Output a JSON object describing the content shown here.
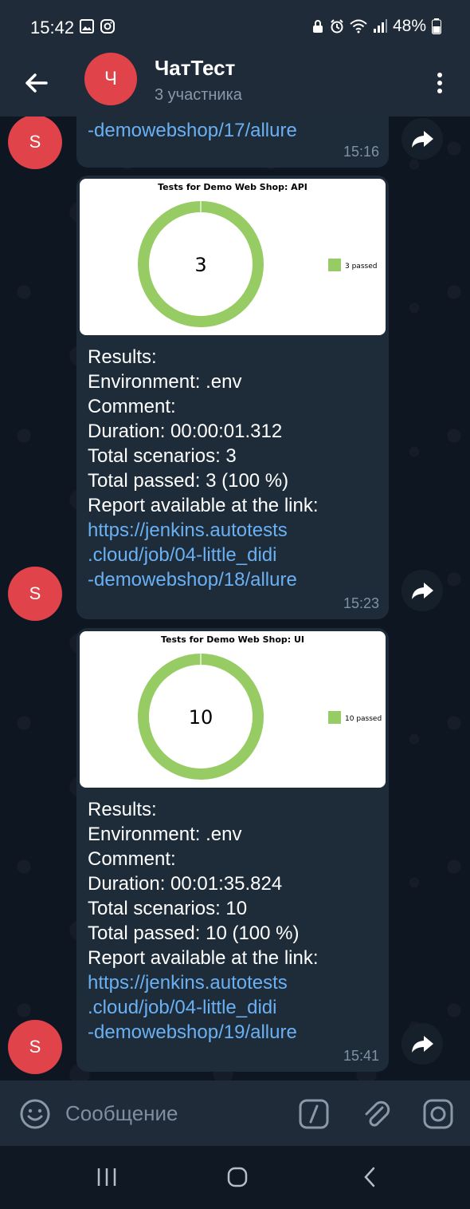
{
  "statusbar": {
    "time": "15:42",
    "battery": "48%",
    "icons_left": [
      "image-icon",
      "instagram-icon"
    ],
    "icons_right": [
      "lock-icon",
      "alarm-icon",
      "wifi-icon",
      "signal-icon",
      "battery-icon"
    ]
  },
  "header": {
    "avatar_letter": "Ч",
    "title": "ЧатТест",
    "subtitle": "3 участника"
  },
  "messages": [
    {
      "avatar": "S",
      "link_tail": "-demowebshop/17/allure",
      "time": "15:16"
    },
    {
      "avatar": "S",
      "chart_data": {
        "type": "pie",
        "title": "Tests for Demo Web Shop: API",
        "center_label": "3",
        "series": [
          {
            "name": "3 passed",
            "values": [
              3
            ]
          }
        ],
        "legend": "right",
        "color": "#97cc64"
      },
      "lines": [
        {
          "label": "Results:",
          "value": ""
        },
        {
          "label": "Environment:",
          "value": " .env"
        },
        {
          "label": "Comment:",
          "value": ""
        },
        {
          "label": "Duration:",
          "value": " 00:00:01.312"
        },
        {
          "label": "Total scenarios:",
          "value": " 3"
        },
        {
          "label": "Total passed:",
          "value": " 3 (100 %)"
        },
        {
          "label": "Report available at the link:",
          "value": ""
        }
      ],
      "link_lines": [
        "https://jenkins.autotests",
        ".cloud/job/04-little_didi",
        "-demowebshop/18/allure"
      ],
      "time": "15:23"
    },
    {
      "avatar": "S",
      "chart_data": {
        "type": "pie",
        "title": "Tests for Demo Web Shop: UI",
        "center_label": "10",
        "series": [
          {
            "name": "10 passed",
            "values": [
              10
            ]
          }
        ],
        "legend": "right",
        "color": "#97cc64"
      },
      "lines": [
        {
          "label": "Results:",
          "value": ""
        },
        {
          "label": "Environment:",
          "value": " .env"
        },
        {
          "label": "Comment:",
          "value": ""
        },
        {
          "label": "Duration:",
          "value": " 00:01:35.824"
        },
        {
          "label": "Total scenarios:",
          "value": " 10"
        },
        {
          "label": "Total passed:",
          "value": " 10 (100 %)"
        },
        {
          "label": "Report available at the link:",
          "value": ""
        }
      ],
      "link_lines": [
        "https://jenkins.autotests",
        ".cloud/job/04-little_didi",
        "-demowebshop/19/allure"
      ],
      "time": "15:41"
    }
  ],
  "composer": {
    "placeholder": "Сообщение"
  },
  "colors": {
    "accent_link": "#6ab0f3",
    "avatar": "#e0434a",
    "bubble": "#1e2c3a",
    "header": "#1f2b38"
  }
}
